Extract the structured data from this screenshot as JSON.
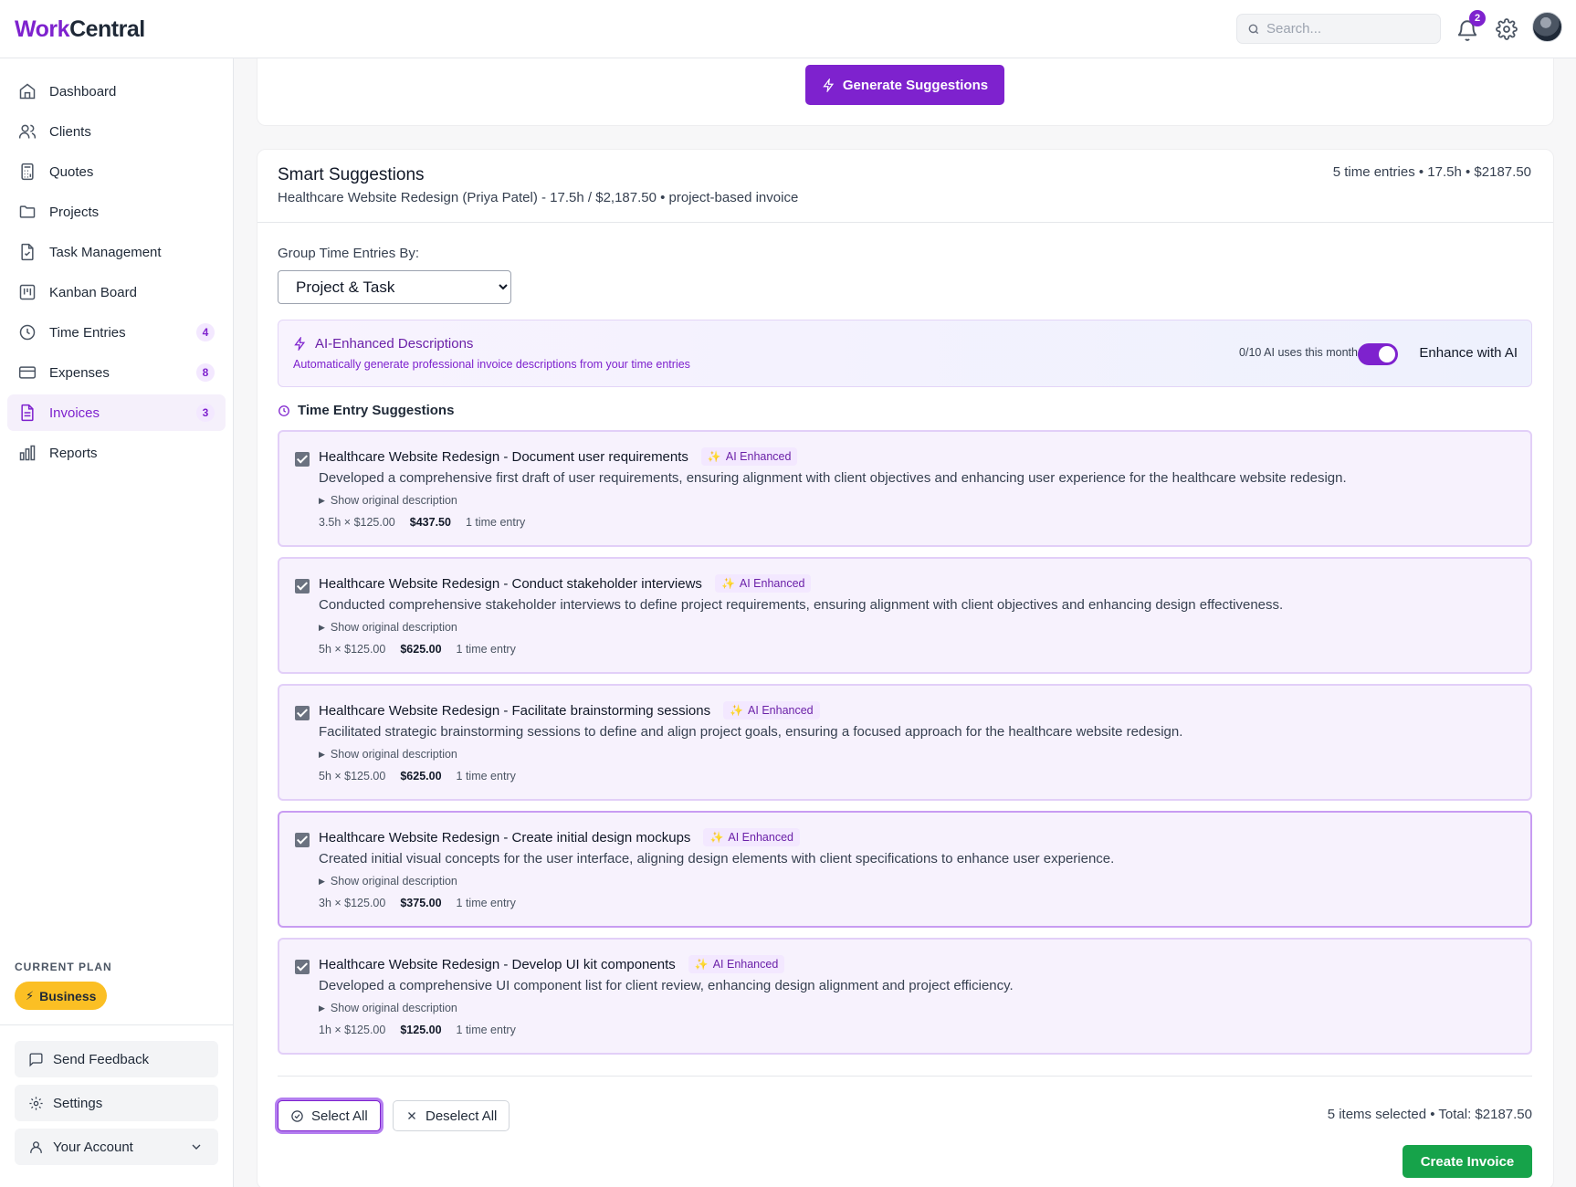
{
  "app": {
    "brand_work": "Work",
    "brand_central": "Central"
  },
  "header": {
    "search_placeholder": "Search...",
    "notification_count": "2"
  },
  "sidebar": {
    "items": [
      {
        "label": "Dashboard",
        "icon": "home-icon"
      },
      {
        "label": "Clients",
        "icon": "users-icon"
      },
      {
        "label": "Quotes",
        "icon": "calculator-icon"
      },
      {
        "label": "Projects",
        "icon": "folder-icon"
      },
      {
        "label": "Task Management",
        "icon": "file-check-icon"
      },
      {
        "label": "Kanban Board",
        "icon": "kanban-icon"
      },
      {
        "label": "Time Entries",
        "icon": "clock-icon",
        "count": "4"
      },
      {
        "label": "Expenses",
        "icon": "credit-card-icon",
        "count": "8"
      },
      {
        "label": "Invoices",
        "icon": "invoice-icon",
        "count": "3",
        "active": true
      },
      {
        "label": "Reports",
        "icon": "bar-chart-icon"
      }
    ],
    "plan_label": "CURRENT PLAN",
    "plan_name": "Business",
    "feedback_label": "Send Feedback",
    "settings_label": "Settings",
    "account_label": "Your Account"
  },
  "generate": {
    "label": "Generate Suggestions"
  },
  "suggestions": {
    "title": "Smart Suggestions",
    "subtitle": "Healthcare Website Redesign (Priya Patel) - 17.5h / $2,187.50 • project-based invoice",
    "summary": "5 time entries • 17.5h • $2187.50",
    "group_label": "Group Time Entries By:",
    "group_value": "Project & Task",
    "group_options": [
      "Project & Task"
    ],
    "ai_title": "AI-Enhanced Descriptions",
    "ai_subtitle": "Automatically generate professional invoice descriptions from your time entries",
    "ai_uses": "0/10 AI uses this month",
    "ai_toggle_label": "Enhance with AI",
    "ai_enabled": true,
    "section_title": "Time Entry Suggestions",
    "chip_label": "AI Enhanced",
    "show_original": "Show original description",
    "items": [
      {
        "title": "Healthcare Website Redesign - Document user requirements",
        "description": "Developed a comprehensive first draft of user requirements, ensuring alignment with client objectives and enhancing user experience for the healthcare website redesign.",
        "rate": "3.5h × $125.00",
        "amount": "$437.50",
        "entries": "1 time entry",
        "checked": true
      },
      {
        "title": "Healthcare Website Redesign - Conduct stakeholder interviews",
        "description": "Conducted comprehensive stakeholder interviews to define project requirements, ensuring alignment with client objectives and enhancing design effectiveness.",
        "rate": "5h × $125.00",
        "amount": "$625.00",
        "entries": "1 time entry",
        "checked": true
      },
      {
        "title": "Healthcare Website Redesign - Facilitate brainstorming sessions",
        "description": "Facilitated strategic brainstorming sessions to define and align project goals, ensuring a focused approach for the healthcare website redesign.",
        "rate": "5h × $125.00",
        "amount": "$625.00",
        "entries": "1 time entry",
        "checked": true
      },
      {
        "title": "Healthcare Website Redesign - Create initial design mockups",
        "description": "Created initial visual concepts for the user interface, aligning design elements with client specifications to enhance user experience.",
        "rate": "3h × $125.00",
        "amount": "$375.00",
        "entries": "1 time entry",
        "checked": true
      },
      {
        "title": "Healthcare Website Redesign - Develop UI kit components",
        "description": "Developed a comprehensive UI component list for client review, enhancing design alignment and project efficiency.",
        "rate": "1h × $125.00",
        "amount": "$125.00",
        "entries": "1 time entry",
        "checked": true
      }
    ],
    "select_all": "Select All",
    "deselect_all": "Deselect All",
    "selection_summary": "5 items selected • Total: $2187.50",
    "create_invoice": "Create Invoice"
  },
  "colors": {
    "accent": "#7e22ce",
    "success": "#16a34a",
    "plan": "#fbbf24"
  }
}
